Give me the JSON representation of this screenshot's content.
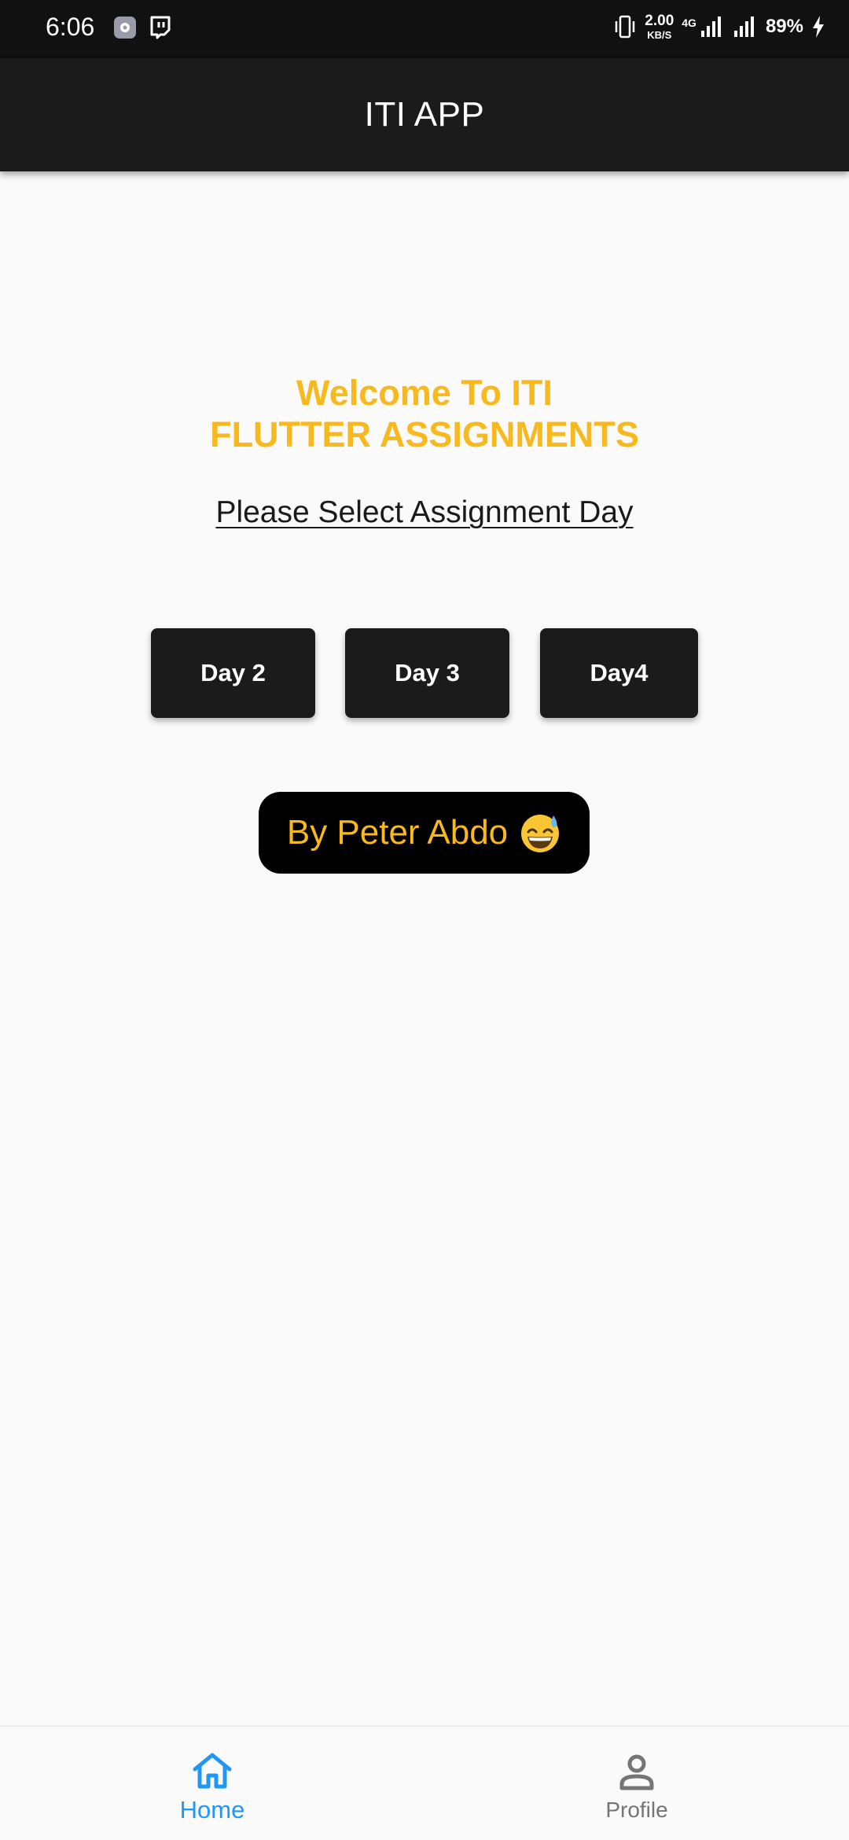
{
  "status_bar": {
    "time": "6:06",
    "net_speed_value": "2.00",
    "net_speed_unit": "KB/S",
    "network_type": "4G",
    "battery": "89%",
    "icons": [
      "settings-app-icon",
      "twitch-icon",
      "vibrate-icon",
      "signal-icon",
      "signal-icon",
      "charging-icon"
    ]
  },
  "app_bar": {
    "title": "ITI APP"
  },
  "main": {
    "welcome_line1": "Welcome To ITI",
    "welcome_line2": "FLUTTER ASSIGNMENTS",
    "subtitle": "Please Select Assignment Day",
    "day_buttons": [
      "Day 2",
      "Day 3",
      "Day4"
    ],
    "author": "By Peter Abdo"
  },
  "bottom_nav": {
    "items": [
      {
        "label": "Home",
        "icon": "home-icon",
        "active": true
      },
      {
        "label": "Profile",
        "icon": "person-icon",
        "active": false
      }
    ]
  },
  "colors": {
    "accent_yellow": "#f8b91e",
    "app_bar": "#1b1b1b",
    "active_nav": "#2196f3",
    "inactive_nav": "#757575",
    "background": "#fafafa"
  }
}
